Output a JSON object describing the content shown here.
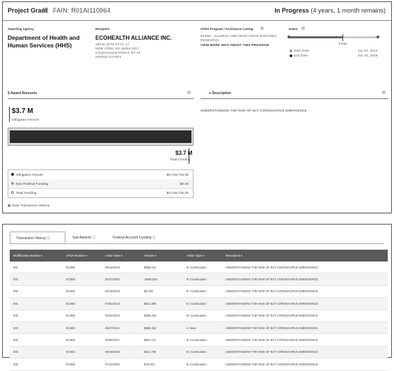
{
  "header": {
    "title": "Project Grant",
    "fain": "FAIN: R01AI110964",
    "status_main": "In Progress",
    "status_detail": "(4 years, 1 month remains)"
  },
  "awarding_agency": {
    "label": "Awarding Agency",
    "name_line1": "Department of Health and",
    "name_line2": "Human Services (HHS)"
  },
  "recipient": {
    "label": "Recipient",
    "name": "ECOHEALTH ALLIANCE INC.",
    "address": [
      "460 W 34TH ST FL 17",
      "NEW YORK, NY 10001-2317",
      "Congressional District: NY-10",
      "UNITED STATES"
    ]
  },
  "cfda": {
    "label": "CFDA Program / Assistance Listing",
    "line1": "93.855 - ALLERGY AND INFECTIOUS DISEASES",
    "line2": "RESEARCH",
    "link": "VIEW MORE INFO ABOUT THIS PROGRAM"
  },
  "dates": {
    "label": "Dates",
    "today": "Today",
    "progress": 0.6,
    "start_label": "Start Date",
    "start_value": "Jun 01, 2014",
    "end_label": "End Date",
    "end_value": "Jun 30, 2025"
  },
  "amounts": {
    "section_label": "$ Award Amounts",
    "obligated_big": "$3.7 M",
    "obligated_caption": "Obligated Amount",
    "total_big": "$3.7 M",
    "total_caption": "Total Funding",
    "rows": [
      {
        "label": "Obligated Amount",
        "value": "$3,748,715.00"
      },
      {
        "label": "Non-Federal Funding",
        "value": "$0.00"
      },
      {
        "label": "Total Funding",
        "value": "$3,748,715.00"
      }
    ],
    "view_history": "View Transaction History"
  },
  "description": {
    "label": "Description",
    "text": "UNDERSTANDING THE RISK OF BAT CORONAVIRUS EMERGENCE"
  },
  "tabs": [
    {
      "label": "Transaction History"
    },
    {
      "label": "Sub-Awards"
    },
    {
      "label": "Federal Account Funding"
    }
  ],
  "table": {
    "headers": [
      "Modification Number",
      "CFDA Number",
      "Action Date",
      "Amount",
      "Action Type",
      "Description"
    ],
    "rows": [
      [
        "001",
        "93.855",
        "05/14/2019",
        "$586,011",
        "B: Continuation",
        "UNDERSTANDING THE RISK OF BAT CORONAVIRUS EMERGENCE"
      ],
      [
        "002",
        "93.855",
        "04/27/2020",
        "-$369,819",
        "B: Continuation",
        "UNDERSTANDING THE RISK OF BAT CORONAVIRUS EMERGENCE"
      ],
      [
        "002",
        "93.855",
        "04/19/2019",
        "$0,100",
        "B: Continuation",
        "UNDERSTANDING THE RISK OF BAT CORONAVIRUS EMERGENCE"
      ],
      [
        "001",
        "93.855",
        "07/02/2018",
        "$661,980",
        "B: Continuation",
        "UNDERSTANDING THE RISK OF BAT CORONAVIRUS EMERGENCE"
      ],
      [
        "000",
        "93.855",
        "05/24/2016",
        "$588,445",
        "B: Continuation",
        "UNDERSTANDING THE RISK OF BAT CORONAVIRUS EMERGENCE"
      ],
      [
        "000",
        "93.855",
        "05/27/2014",
        "$666,442",
        "A: New",
        "UNDERSTANDING THE RISK OF BAT CORONAVIRUS EMERGENCE"
      ],
      [
        "000",
        "93.855",
        "05/06/2017",
        "$597,112",
        "B: Continuation",
        "UNDERSTANDING THE RISK OF BAT CORONAVIRUS EMERGENCE"
      ],
      [
        "000",
        "93.855",
        "06/19/2015",
        "$611,790",
        "B: Continuation",
        "UNDERSTANDING THE RISK OF BAT CORONAVIRUS EMERGENCE"
      ],
      [
        "000",
        "93.855",
        "07/12/2020",
        "$76,301",
        "B: Continuation",
        "UNDERSTANDING THE RISK OF BAT CORONAVIRUS EMERGENCE"
      ]
    ]
  }
}
